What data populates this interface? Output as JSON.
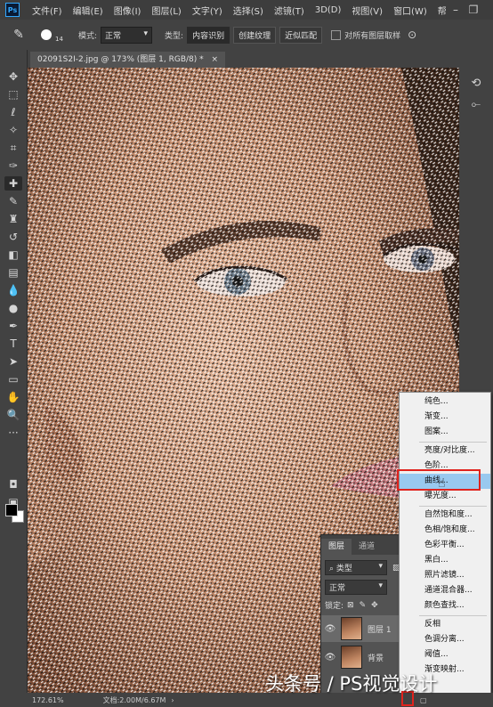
{
  "app": {
    "logo": "Ps"
  },
  "menubar": [
    "文件(F)",
    "编辑(E)",
    "图像(I)",
    "图层(L)",
    "文字(Y)",
    "选择(S)",
    "滤镜(T)",
    "3D(D)",
    "视图(V)",
    "窗口(W)",
    "帮"
  ],
  "options": {
    "brush_size": "14",
    "mode_label": "模式:",
    "mode_value": "正常",
    "type_label": "类型:",
    "type_buttons": [
      "内容识别",
      "创建纹理",
      "近似匹配"
    ],
    "sample_all_label": "对所有图层取样"
  },
  "document_tab": "02091S2I-2.jpg @ 173% (图层 1, RGB/8) *",
  "layers_panel": {
    "tabs": [
      "图层",
      "通道"
    ],
    "filter_value": "类型",
    "blend_mode": "正常",
    "lock_label": "锁定:",
    "layers": [
      {
        "name": "图层 1",
        "selected": true
      },
      {
        "name": "背景",
        "selected": false
      }
    ]
  },
  "adjustment_menu": {
    "items": [
      "纯色...",
      "渐变...",
      "图案...",
      "亮度/对比度...",
      "色阶...",
      "曲线...",
      "曝光度...",
      "自然饱和度...",
      "色相/饱和度...",
      "色彩平衡...",
      "黑白...",
      "照片滤镜...",
      "通道混合器...",
      "颜色查找...",
      "反相",
      "色调分离...",
      "阈值...",
      "渐变映射..."
    ],
    "highlighted_index": 5
  },
  "status": {
    "zoom": "172.61%",
    "doc_info": "文档:2.00M/6.67M"
  },
  "watermark": "头条号 / PS视觉设计",
  "colors": {
    "highlight": "#99c9ef",
    "annotation_red": "#e0231d",
    "panel_dark": "#424242"
  },
  "icons": {
    "left_tools": [
      "move-icon",
      "marquee-icon",
      "lasso-icon",
      "quick-select-icon",
      "crop-icon",
      "eyedropper-icon",
      "healing-brush-icon",
      "brush-icon",
      "clone-stamp-icon",
      "history-brush-icon",
      "eraser-icon",
      "gradient-icon",
      "blur-icon",
      "dodge-icon",
      "pen-icon",
      "type-icon",
      "path-select-icon",
      "rectangle-icon",
      "hand-icon",
      "zoom-icon",
      "more-icon"
    ],
    "right_tools": [
      "history-icon",
      "paths-icon"
    ]
  }
}
